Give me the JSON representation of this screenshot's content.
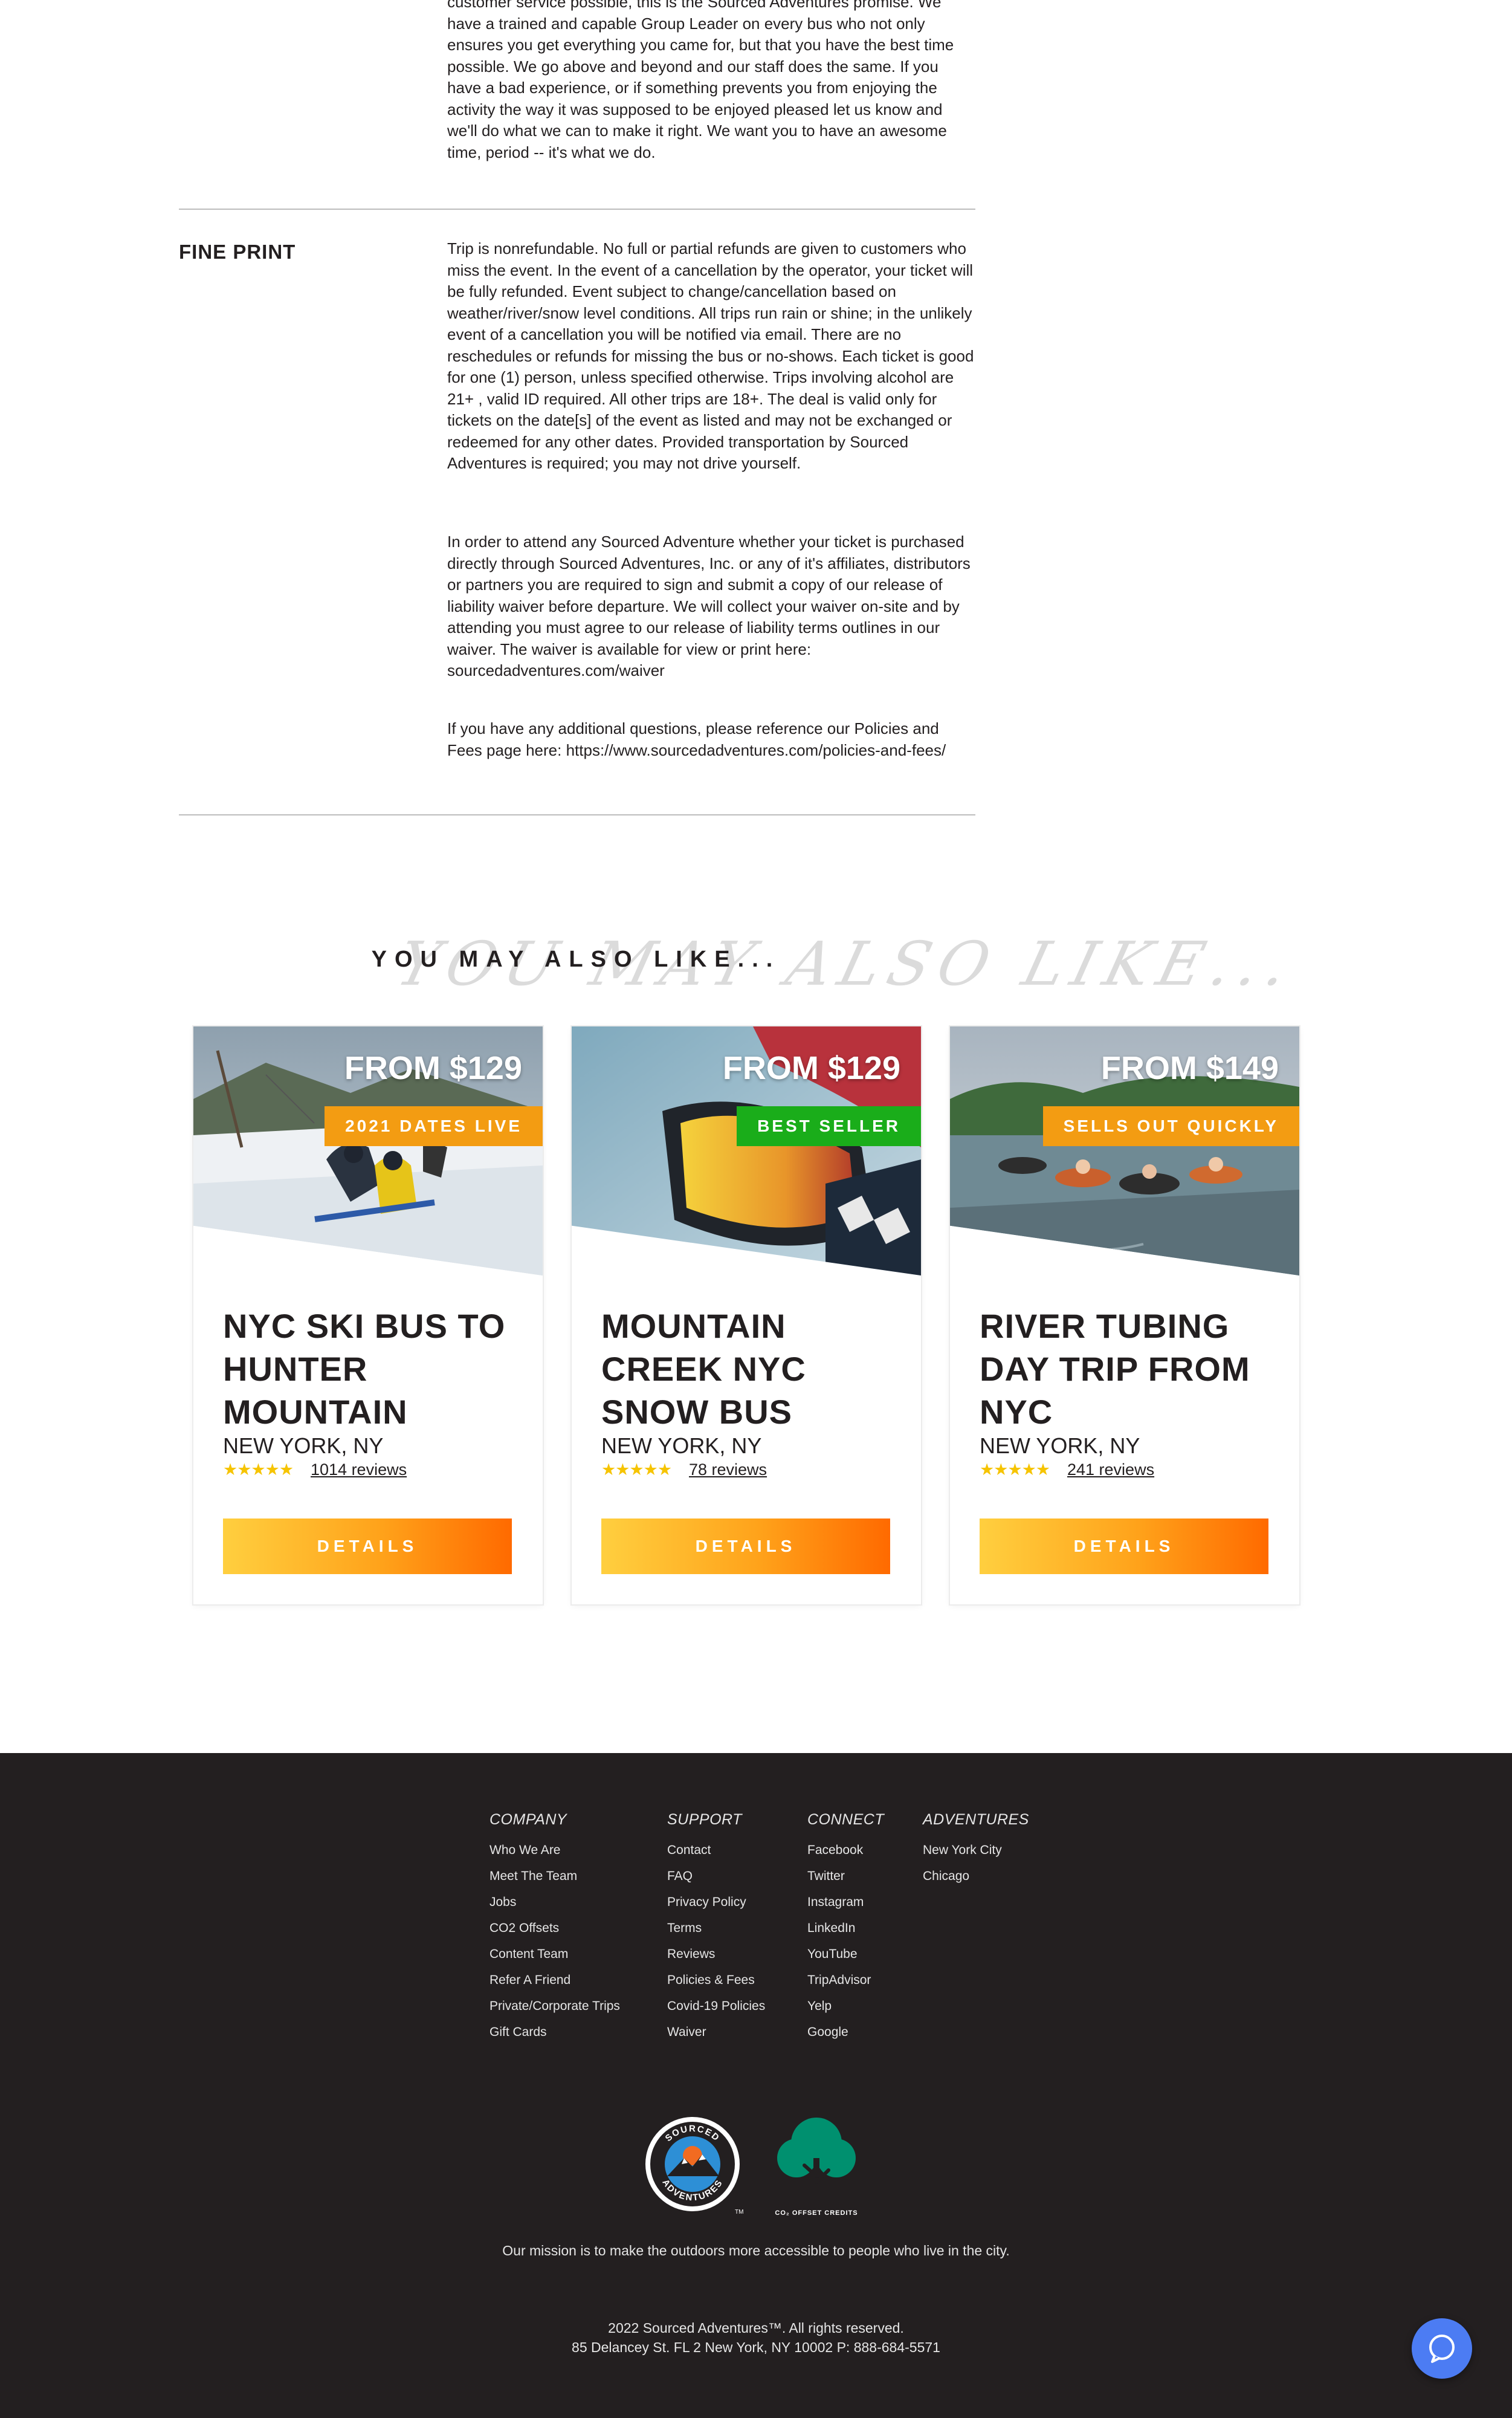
{
  "details": {
    "guarantee_paragraph": "customer service possible, this is the Sourced Adventures promise. We have a trained and capable Group Leader on every bus who not only ensures you get everything you came for, but that you have the best time possible. We go above and beyond and our staff does the same. If you have a bad experience, or if something prevents you from enjoying the activity the way it was supposed to be enjoyed pleased let us know and we'll do what we can to make it right. We want you to have an awesome time, period -- it's what we do.",
    "fine_print_heading": "FINE PRINT",
    "fine_print_p1": "Trip is nonrefundable. No full or partial refunds are given to customers who miss the event. In the event of a cancellation by the operator, your ticket will be fully refunded. Event subject to change/cancellation based on weather/river/snow level conditions. All trips run rain or shine; in the unlikely event of a cancellation you will be notified via email. There are no reschedules or refunds for missing the bus or no-shows. Each ticket is good for one (1) person, unless specified otherwise. Trips involving alcohol are 21+ , valid ID required. All other trips are 18+. The deal is valid only for tickets on the date[s] of the event as listed and may not be exchanged or redeemed for any other dates. Provided transportation by Sourced Adventures is required; you may not drive yourself.",
    "fine_print_p2": "In order to attend any Sourced Adventure whether your ticket is purchased directly through Sourced Adventures, Inc. or any of it's affiliates, distributors or partners you are required to sign and submit a copy of our release of liability waiver before departure. We will collect your waiver on-site and by attending you must agree to our release of liability terms outlines in our waiver. The waiver is available for view or print here: sourcedadventures.com/waiver",
    "fine_print_p3": "If you have any additional questions, please reference our Policies and Fees page here: https://www.sourcedadventures.com/policies-and-fees/"
  },
  "related": {
    "heading": "YOU MAY ALSO LIKE...",
    "heading_script": "YOU MAY ALSO LIKE...",
    "cards": [
      {
        "price": "FROM $129",
        "badge": "2021 DATES LIVE",
        "badge_color": "#f39c12",
        "title": "NYC SKI BUS TO HUNTER MOUNTAIN",
        "location": "NEW YORK, NY",
        "stars": "★★★★★",
        "reviews": "1014 reviews",
        "button": "DETAILS"
      },
      {
        "price": "FROM $129",
        "badge": "BEST SELLER",
        "badge_color": "#1aad1a",
        "title": "MOUNTAIN CREEK NYC SNOW BUS",
        "location": "NEW YORK, NY",
        "stars": "★★★★★",
        "reviews": "78 reviews",
        "button": "DETAILS"
      },
      {
        "price": "FROM $149",
        "badge": "SELLS OUT QUICKLY",
        "badge_color": "#f39c12",
        "title": "RIVER TUBING DAY TRIP FROM NYC",
        "location": "NEW YORK, NY",
        "stars": "★★★★★",
        "reviews": "241 reviews",
        "button": "DETAILS"
      }
    ]
  },
  "footer": {
    "columns": [
      {
        "heading": "COMPANY",
        "links": [
          "Who We Are",
          "Meet The Team",
          "Jobs",
          "CO2 Offsets",
          "Content Team",
          "Refer A Friend",
          "Private/Corporate Trips",
          "Gift Cards"
        ]
      },
      {
        "heading": "SUPPORT",
        "links": [
          "Contact",
          "FAQ",
          "Privacy Policy",
          "Terms",
          "Reviews",
          "Policies & Fees",
          "Covid-19 Policies",
          "Waiver"
        ]
      },
      {
        "heading": "CONNECT",
        "links": [
          "Facebook",
          "Twitter",
          "Instagram",
          "LinkedIn",
          "YouTube",
          "TripAdvisor",
          "Yelp",
          "Google"
        ]
      },
      {
        "heading": "ADVENTURES",
        "links": [
          "New York City",
          "Chicago"
        ]
      }
    ],
    "logo_text_top": "SOURCED",
    "logo_text_bottom": "ADVENTURES",
    "logo_tm": "TM",
    "offset_label": "CO₂ OFFSET CREDITS",
    "mission": "Our mission is to make the outdoors more accessible to people who live in the city.",
    "copyright": "2022 Sourced Adventures™. All rights reserved.",
    "address": "85 Delancey St. FL 2 New York, NY 10002 P: 888-684-5571"
  },
  "colors": {
    "footer_bg": "#231f20",
    "chat_button": "#4c7cf3",
    "button_gradient_start": "#ffcf3f",
    "button_gradient_end": "#ff6a00"
  },
  "icons": {
    "chat": "chat-bubble-icon",
    "logo": "sourced-adventures-logo",
    "tree": "tree-icon"
  }
}
